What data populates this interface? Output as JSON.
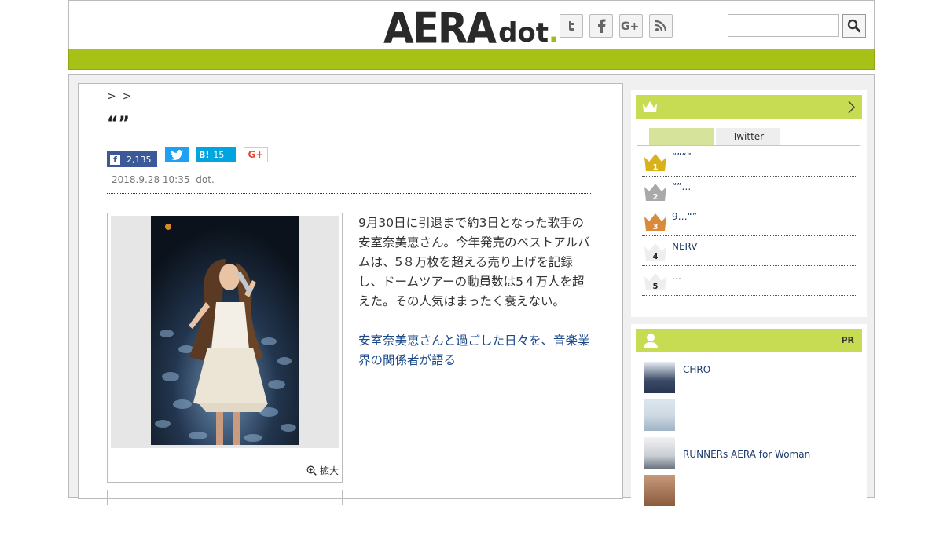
{
  "header": {
    "logo_main": "AERA",
    "logo_sub": "dot",
    "logo_period": ".",
    "social": [
      {
        "icon": "twitter-icon",
        "glyph": "t"
      },
      {
        "icon": "facebook-icon",
        "glyph": "f"
      },
      {
        "icon": "googleplus-icon",
        "glyph": "G+"
      },
      {
        "icon": "rss-icon",
        "glyph": "◉"
      }
    ],
    "search_placeholder": ""
  },
  "article": {
    "breadcrumb": [
      ">",
      ">"
    ],
    "title": "“”",
    "share": {
      "fb_count": "2,135",
      "hatebu_label": "B!",
      "hatebu_count": "15",
      "gplus_label": "G+"
    },
    "date": "2018.9.28 10:35",
    "source": "dot.",
    "enlarge": "拡大",
    "paragraphs": [
      "9月30日に引退まで約3日となった歌手の安室奈美恵さん。今年発売のベストアルバムは、5８万枚を超える売り上げを記録し、ドームツアーの動員数は5４万人を超えた。その人気はまったく衰えない。",
      "安室奈美恵さんと過ごした日々を、音楽業界の関係者が語る",
      "＿＿＿＿＿＿＿＿＿＿＿＿＿＿＿＿＿＿＿＿＿＿＿＿＿＿＿＿＿＿＿＿＿＿＿＿＿＿＿＿＿＿＿＿＿＿＿＿＿＿＿＿＿＿",
      "＿＿＿＿＿＿＿＿＿＿＿＿＿＿＿＿＿＿＿＿＿＿＿＿＿＿＿＿＿＿＿＿＿＿＿＿＿＿＿＿＿"
    ]
  },
  "ranking": {
    "tabs": [
      "",
      "Twitter"
    ],
    "items": [
      {
        "num": "1",
        "text": "“”“”",
        "color": "#d9b11a"
      },
      {
        "num": "2",
        "text": "“”…",
        "color": "#a9a9a9"
      },
      {
        "num": "3",
        "text": "9…“”",
        "color": "#d98a3a"
      },
      {
        "num": "4",
        "text": "NERV",
        "color": "#ffffff"
      },
      {
        "num": "5",
        "text": "…",
        "color": "#ffffff"
      }
    ]
  },
  "pr": {
    "label": "PR",
    "items": [
      {
        "text": "CHRO"
      },
      {
        "text": ""
      },
      {
        "text": "RUNNERs AERA for Woman"
      },
      {
        "text": ""
      }
    ]
  },
  "colors": {
    "accent": "#a7c117",
    "accent_light": "#c7dc52"
  }
}
